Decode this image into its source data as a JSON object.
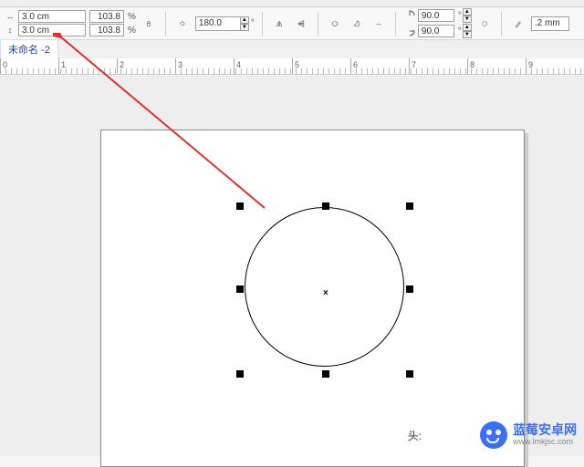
{
  "toolbar": {
    "width_value": "3.0 cm",
    "height_value": "3.0 cm",
    "width_pct": "103.8",
    "height_pct": "103.8",
    "pct_unit": "%",
    "rotation": "180.0",
    "angle1": "90.0",
    "angle2": "90.0",
    "degree": "°",
    "outline_w": ".2 mm"
  },
  "doc_tab": "未命名 -2",
  "ruler": [
    "0",
    "1",
    "2",
    "3",
    "4",
    "5",
    "6",
    "7",
    "8",
    "9"
  ],
  "footer": {
    "tou": "头:",
    "wm_cn": "蓝莓安卓网",
    "wm_en": "www.lmkjsc.com"
  }
}
